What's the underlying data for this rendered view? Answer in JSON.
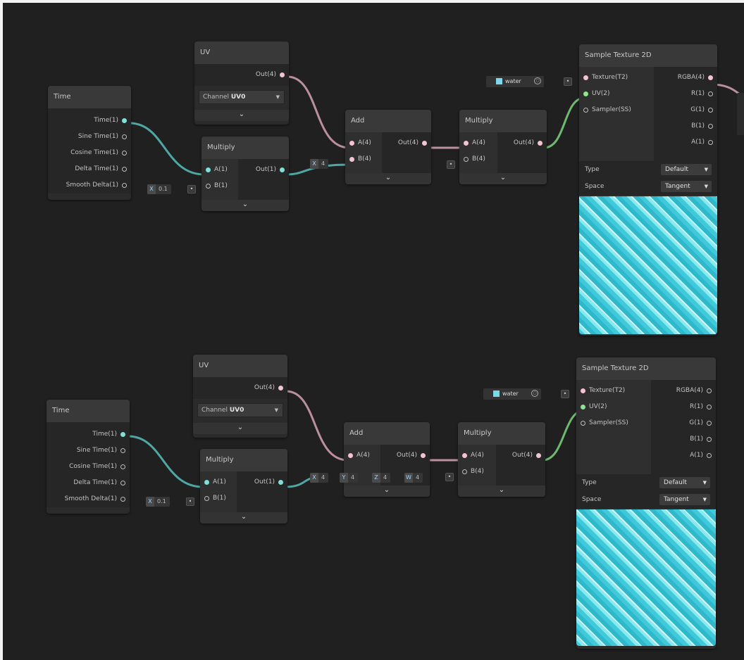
{
  "graph": {
    "row1": {
      "time_node": {
        "title": "Time",
        "outputs": [
          "Time(1)",
          "Sine Time(1)",
          "Cosine Time(1)",
          "Delta Time(1)",
          "Smooth Delta(1)"
        ]
      },
      "uv_node": {
        "title": "UV",
        "output": "Out(4)",
        "channel_label": "Channel",
        "channel_value": "UV0"
      },
      "multiply_a": {
        "title": "Multiply",
        "inputs": [
          "A(1)",
          "B(1)"
        ],
        "output": "Out(1)",
        "b_default": {
          "axis": "X",
          "value": "0.1"
        }
      },
      "add_node": {
        "title": "Add",
        "inputs": [
          "A(4)",
          "B(4)"
        ],
        "output": "Out(4)",
        "b_default": {
          "axis": "X",
          "value": "4"
        }
      },
      "multiply_b": {
        "title": "Multiply",
        "inputs": [
          "A(4)",
          "B(4)"
        ],
        "output": "Out(4)"
      },
      "sample_node": {
        "title": "Sample Texture 2D",
        "inputs": [
          "Texture(T2)",
          "UV(2)",
          "Sampler(SS)"
        ],
        "outputs": [
          "RGBA(4)",
          "R(1)",
          "G(1)",
          "B(1)",
          "A(1)"
        ],
        "type_label": "Type",
        "type_value": "Default",
        "space_label": "Space",
        "space_value": "Tangent"
      },
      "texture_chip": "water"
    },
    "row2": {
      "time_node": {
        "title": "Time",
        "outputs": [
          "Time(1)",
          "Sine Time(1)",
          "Cosine Time(1)",
          "Delta Time(1)",
          "Smooth Delta(1)"
        ]
      },
      "uv_node": {
        "title": "UV",
        "output": "Out(4)",
        "channel_label": "Channel",
        "channel_value": "UV0"
      },
      "multiply_a": {
        "title": "Multiply",
        "inputs": [
          "A(1)",
          "B(1)"
        ],
        "output": "Out(1)",
        "b_default": {
          "axis": "X",
          "value": "0.1"
        }
      },
      "add_node": {
        "title": "Add",
        "inputs": [
          "A(4)",
          "B(4)"
        ],
        "output": "Out(4)",
        "b_default": [
          {
            "axis": "X",
            "value": "4"
          },
          {
            "axis": "Y",
            "value": "4"
          },
          {
            "axis": "Z",
            "value": "4"
          },
          {
            "axis": "W",
            "value": "4"
          }
        ]
      },
      "multiply_b": {
        "title": "Multiply",
        "inputs": [
          "A(4)",
          "B(4)"
        ],
        "output": "Out(4)"
      },
      "sample_node": {
        "title": "Sample Texture 2D",
        "inputs": [
          "Texture(T2)",
          "UV(2)",
          "Sampler(SS)"
        ],
        "outputs": [
          "RGBA(4)",
          "R(1)",
          "G(1)",
          "B(1)",
          "A(1)"
        ],
        "type_label": "Type",
        "type_value": "Default",
        "space_label": "Space",
        "space_value": "Tangent"
      },
      "texture_chip": "water"
    }
  },
  "colors": {
    "canvas": "#202020",
    "wire_pink": "#b9909c",
    "wire_teal": "#4fa7a4",
    "wire_green": "#6fb86f"
  }
}
